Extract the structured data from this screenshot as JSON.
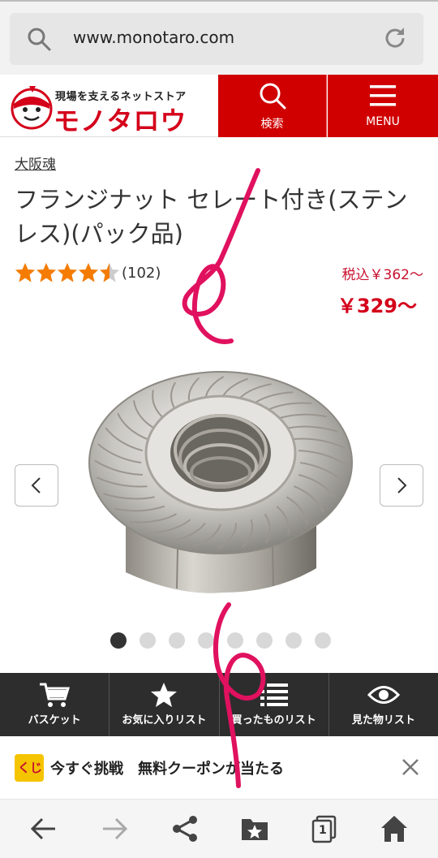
{
  "browser": {
    "url": "www.monotaro.com"
  },
  "header": {
    "tagline": "現場を支えるネットストア",
    "brand": "モノタロウ",
    "search_label": "検索",
    "menu_label": "MENU"
  },
  "product": {
    "brand_link": "大阪魂",
    "title": "フランジナット セレート付き(ステンレス)(パック品)",
    "rating": 4.5,
    "review_count": "(102)",
    "price_tax_included": "税込￥362～",
    "price": "￥329～"
  },
  "gallery": {
    "image_count": 8,
    "active_index": 0
  },
  "app_nav": {
    "items": [
      {
        "label": "バスケット",
        "icon": "cart-icon"
      },
      {
        "label": "お気に入りリスト",
        "icon": "star-icon"
      },
      {
        "label": "買ったものリスト",
        "icon": "list-icon"
      },
      {
        "label": "見た物リスト",
        "icon": "eye-icon"
      }
    ]
  },
  "banner": {
    "icon_text": "くじ",
    "text": "今すぐ挑戦　無料クーポンが当たる"
  },
  "browser_nav": {
    "tabs_count": "1"
  },
  "colors": {
    "brand_red": "#d00000",
    "price_red": "#d4001a",
    "star_orange": "#f57c00",
    "nav_dark": "#2d2d2d",
    "annotation_pink": "#e0115f"
  }
}
